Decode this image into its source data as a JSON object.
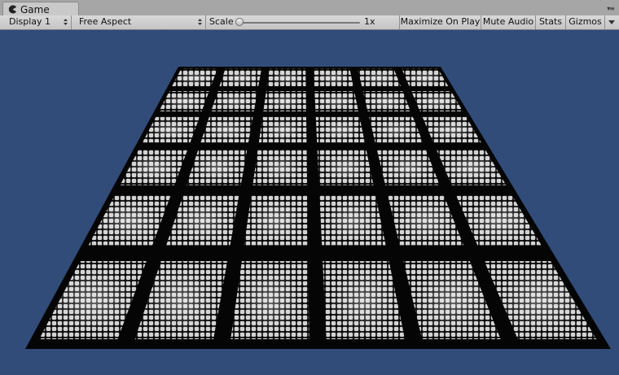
{
  "tab": {
    "title": "Game",
    "icon": "pacman-icon"
  },
  "panel_menu_icon": "panel-menu-icon",
  "toolbar": {
    "display": "Display 1",
    "aspect": "Free Aspect",
    "scale_label": "Scale",
    "scale_value": "1x",
    "scale_level": 0.0,
    "maximize_on_play": "Maximize On Play",
    "mute_audio": "Mute Audio",
    "stats": "Stats",
    "gizmos": "Gizmos"
  },
  "viewport": {
    "background": "#314c79",
    "content": "cobblestone-plane",
    "grid_rows": 6,
    "grid_cols": 6
  }
}
